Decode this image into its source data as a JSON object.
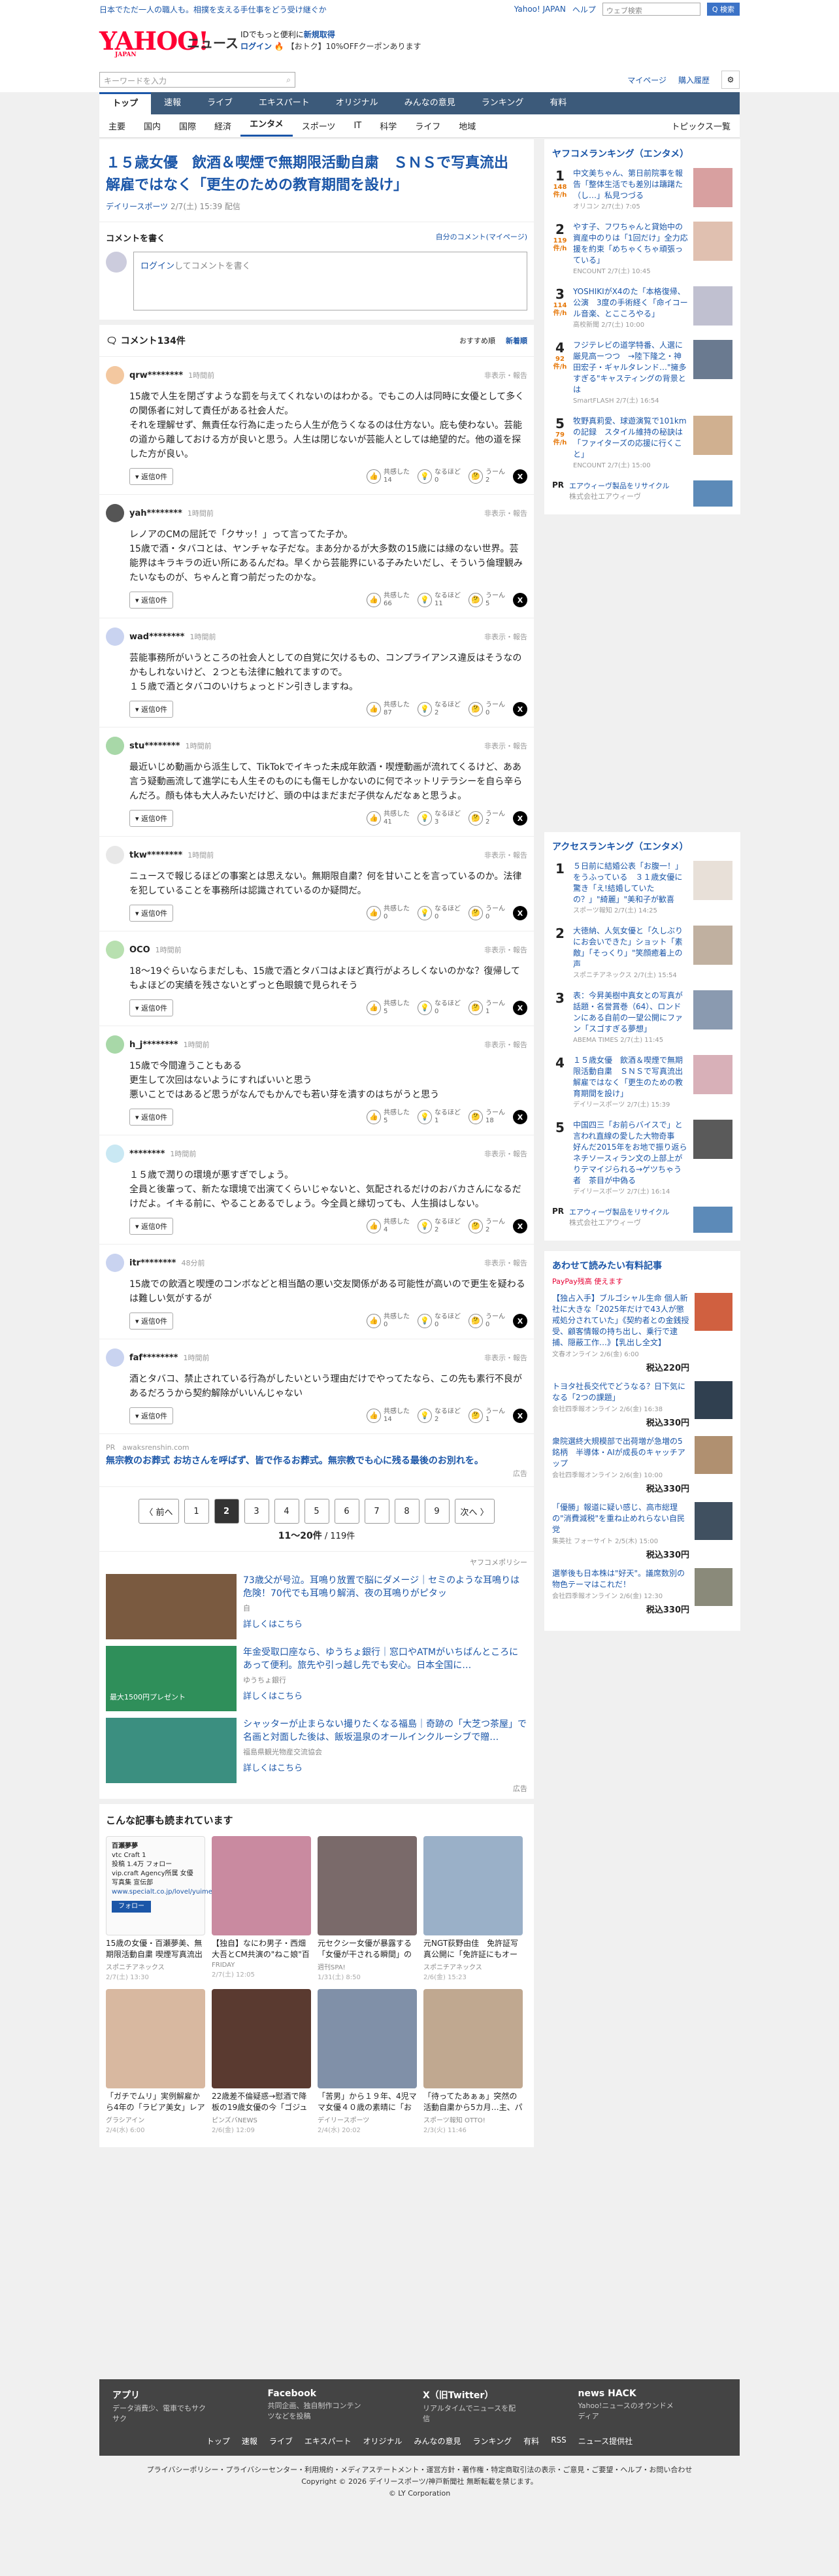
{
  "top": {
    "promo": "日本でただ一人の職人も。相撲を支える手仕事をどう受け継ぐか",
    "links": [
      "Yahoo! JAPAN",
      "ヘルプ"
    ],
    "search_ph": "ウェブ検索",
    "search_btn": "Q 検索"
  },
  "header": {
    "logo": "YAHOO!",
    "logo_sub": "JAPAN",
    "news": "ニュース",
    "id_line1": "IDでもっと便利に",
    "id_line1b": "新規取得",
    "id_line2": "ログイン",
    "id_line2b": "【おトク】10%OFFクーポンあります"
  },
  "search": {
    "placeholder": "キーワードを入力",
    "mypage": "マイページ",
    "history": "購入履歴"
  },
  "nav": [
    "トップ",
    "速報",
    "ライブ",
    "エキスパート",
    "オリジナル",
    "みんなの意見",
    "ランキング",
    "有料"
  ],
  "subnav": [
    "主要",
    "国内",
    "国際",
    "経済",
    "エンタメ",
    "スポーツ",
    "IT",
    "科学",
    "ライフ",
    "地域"
  ],
  "topics": "トピックス一覧",
  "article": {
    "title": "１５歳女優　飲酒＆喫煙で無期限活動自粛　ＳＮＳで写真流出　解雇ではなく「更生のための教育期間を設け」",
    "source": "デイリースポーツ",
    "date": "2/7(土) 15:39 配信"
  },
  "write": {
    "title": "コメントを書く",
    "mine": "自分のコメント(マイページ)",
    "login": "ログイン",
    "prompt": "してコメントを書く"
  },
  "comments_head": {
    "count": "コメント134件",
    "sort1": "おすすめ順",
    "sort2": "新着順"
  },
  "labels": {
    "report": "非表示・報告",
    "reply": "▾ 返信0件",
    "like": "共感した",
    "nrh": "なるほど",
    "hmm": "うーん"
  },
  "comments": [
    {
      "user": "qrw********",
      "time": "1時間前",
      "text": "15歳で人生を閉ざすような罰を与えてくれないのはわかる。でもこの人は同時に女優として多くの関係者に対して責任がある社会人だ。\nそれを理解せず、無責任な行為に走ったら人生が危うくなるのは仕方ない。庇も使わない。芸能の道から離しておける方が良いと思う。人生は閉じないが芸能人としては絶望的だ。他の道を探した方が良い。",
      "a": "14",
      "b": "0",
      "c": "2"
    },
    {
      "user": "yah********",
      "time": "1時間前",
      "text": "レノアのCMの屈託で「クサッ！」って言ってた子か。\n15歳で酒・タバコとは、ヤンチャな子だな。まあ分かるが大多数の15歳には縁のない世界。芸能界はキラキラの近い所にあるんだね。早くから芸能界にいる子みたいだし、そういう倫理観みたいなものが、ちゃんと育つ前だったのかな。",
      "a": "66",
      "b": "11",
      "c": "5"
    },
    {
      "user": "wad********",
      "time": "1時間前",
      "text": "芸能事務所がいうところの社会人としての自覚に欠けるもの、コンプライアンス違反はそうなのかもしれないけど、２つとも法律に触れてますので。\n１５歳で酒とタバコのいけちょっとドン引きしますね。",
      "a": "87",
      "b": "2",
      "c": "0"
    },
    {
      "user": "stu********",
      "time": "1時間前",
      "text": "最近いじめ動画から派生して、TikTokでイキった未成年飲酒・喫煙動画が流れてくるけど、ああ言う疑動画流して進学にも人生そのものにも傷モしかないのに何でネットリテラシーを自ら辛らんだろ。顔も体も大人みたいだけど、頭の中はまだまだ子供なんだなぁと思うよ。",
      "a": "41",
      "b": "3",
      "c": "2"
    },
    {
      "user": "tkw********",
      "time": "1時間前",
      "text": "ニュースで報じるほどの事案とは思えない。無期限自粛？何を甘いことを言っているのか。法律を犯していることを事務所は認識されているのか疑問だ。",
      "a": "0",
      "b": "0",
      "c": "0"
    },
    {
      "user": "OCO",
      "time": "1時間前",
      "text": "18〜19ぐらいならまだしも、15歳で酒とタバコはよほど真行がよろしくないのかな？復帰してもよほどの実績を残さないとずっと色眼鏡で見られそう",
      "a": "5",
      "b": "0",
      "c": "1"
    },
    {
      "user": "h_j********",
      "time": "1時間前",
      "text": "15歳で今間違うこともある\n更生して次回はないようにすればいいと思う\n悪いことではあるど思うがなんでもかんでも若い芽を潰すのはちがうと思う",
      "a": "5",
      "b": "1",
      "c": "18"
    },
    {
      "user": "********",
      "time": "1時間前",
      "text": "１５歳で潤りの環境が悪すぎでしょう。\n全員と後輩って、新たな環境で出演てくらいじゃないと、気配されるだけのおバカさんになるだけだよ。イキる前に、やることあるでしょう。今全員と縁切っても、人生損はしない。",
      "a": "4",
      "b": "2",
      "c": "2"
    },
    {
      "user": "itr********",
      "time": "48分前",
      "text": "15歳での飲酒と喫煙のコンボなどと相当酷の悪い交友関係がある可能性が高いので更生を疑わるは難しい気がするが",
      "a": "0",
      "b": "0",
      "c": "0"
    },
    {
      "user": "faf********",
      "time": "1時間前",
      "text": "酒とタバコ、禁止されている行為がしたいという理由だけでやってたなら、この先も素行不良があるだろうから契約解除がいいんじゃない",
      "a": "14",
      "b": "2",
      "c": "1"
    }
  ],
  "ad": {
    "pr": "PR",
    "domain": "awaksrenshin.com",
    "text": "無宗教のお葬式 お坊さんを呼ばず、皆で作るお葬式。無宗教でも心に残る最後のお別れを。",
    "tag": "広告"
  },
  "pager": {
    "prev": "〈 前へ",
    "pages": [
      "1",
      "2",
      "3",
      "4",
      "5",
      "6",
      "7",
      "8",
      "9"
    ],
    "current": "2",
    "next": "次へ 〉",
    "range": "11〜20件",
    "total": "/ 119件"
  },
  "sponsor": {
    "policy": "ヤフコメポリシー",
    "items": [
      {
        "title": "73歳父が号泣。耳鳴り放置で脳にダメージ｜セミのような耳鳴りは危険！70代でも耳鳴り解消、夜の耳鳴りがピタッ",
        "src": "自",
        "more": "詳しくはこちら"
      },
      {
        "title": "年金受取口座なら、ゆうちょ銀行｜窓口やATMがいちばんところにあって便利。旅先や引っ越し先でも安心。日本全国に…",
        "src": "ゆうちょ銀行",
        "more": "詳しくはこちら",
        "badge": "最大1500円プレゼント"
      },
      {
        "title": "シャッターが止まらない撮りたくなる福島｜奇跡の「大芝つ茶屋」で名画と対面した後は、飯坂温泉のオールインクルーシブで贈…",
        "src": "福島県観光物産交流協会",
        "more": "詳しくはこちら"
      }
    ],
    "tag": "広告"
  },
  "related": {
    "title": "こんな記事も読まれています",
    "items": [
      {
        "t": "15歳の女優・百瀬夢美、無期限活動自粛 喫煙写真流出に事務所…",
        "s": "スポニチアネックス",
        "d": "2/7(土) 13:30"
      },
      {
        "t": "【独自】なにわ男子・西畑大吾とCM共演の\"ねこ娘\"百瀬夢夢が…",
        "s": "FRIDAY",
        "d": "2/7(土) 12:05"
      },
      {
        "t": "元セクシー女優が暴露する「女優が干される瞬間」のリアル。簡…",
        "s": "週刊SPA!",
        "d": "1/31(土) 8:50"
      },
      {
        "t": "元NGT荻野由佳　免許証写真公開に「免許証にもオーラが」「こん…",
        "s": "スポニチアネックス",
        "d": "2/6(金) 15:23"
      },
      {
        "t": "「ガチでムリ」実例解雇から4年の「ラビア美女」レアな発言フ…",
        "s": "グラシアイン",
        "d": "2/4(水) 6:00"
      },
      {
        "t": "22歳差不倫疑惑→慰酒で降板の19歳女優の今「ゴジュウジャー…",
        "s": "ピンズバNEWS",
        "d": "2/6(金) 12:09"
      },
      {
        "t": "「苦男」から１９年、4児ママ女優４０歳の素晴に「お人形さん…",
        "s": "デイリースポーツ",
        "d": "2/4(水) 20:02"
      },
      {
        "t": "「待ってたあぁぁ」突然の活動自粛から5カ月…主、パパになっ…",
        "s": "スポーツ報知 OTTO!",
        "d": "2/3(火) 11:46"
      }
    ],
    "ad": {
      "name": "百瀬夢夢",
      "handle": "vtc Craft 1",
      "posts": "投稿",
      "followers": "1.4万",
      "following": "フォロー",
      "desc": "vip.craft Agency所属 女優 写真集 宣伝部",
      "url": "www.specialt.co.jp/lovel/yuime",
      "follow": "フォロー"
    }
  },
  "ranking": {
    "title": "ヤフコメランキング（エンタメ）",
    "unit": "件/h",
    "items": [
      {
        "no": "1",
        "pv": "148",
        "t": "中文美ちゃん、第日前院事を報告「整体生活でも差別は躊躇た（し…」私見つづる",
        "s": "オリコン 2/7(土) 7:05"
      },
      {
        "no": "2",
        "pv": "119",
        "t": "やす子、フワちゃんと貸始中の資産中のりは「1回だけ」全力応援を約束「めちゃくちゃ頑張っている」",
        "s": "ENCOUNT 2/7(土) 10:45"
      },
      {
        "no": "3",
        "pv": "114",
        "t": "YOSHIKIがX4のた「本格復帰、公演　3度の手術経く「命イコール音楽、とこころやる」",
        "s": "高校新聞 2/7(土) 10:00"
      },
      {
        "no": "4",
        "pv": "92",
        "t": "フジテレビの道学特番、人選に厳見高ーつつ　→陸下隆之・神田宏子・ギャルタレンド…\"擁多すぎる\"キャスティングの背景とは",
        "s": "SmartFLASH 2/7(土) 16:54"
      },
      {
        "no": "5",
        "pv": "79",
        "t": "牧野真莉愛、球遊演覧で101kmの記録　スタイル維持の秘訣は「ファイターズの応援に行くこと」",
        "s": "ENCOUNT 2/7(土) 15:00"
      }
    ],
    "pr": {
      "label": "PR",
      "t": "エアウィーヴ製品をリサイクル",
      "s": "株式会社エアウィーヴ"
    }
  },
  "access": {
    "title": "アクセスランキング（エンタメ）",
    "items": [
      {
        "no": "1",
        "t": "５日前に結婚公表「お腹一！」をうふっている　３１歳女優に驚き「え!結婚していたの？」\"綺麗」\"美和子が歓喜",
        "s": "スポーツ報知 2/7(土) 14:25"
      },
      {
        "no": "2",
        "t": "大徳納、人気女優と「久しぶりにお会いできた」ショット「素敵」「そっくり」\"笑顔癒着上の声",
        "s": "スポニチアネックス 2/7(土) 15:54"
      },
      {
        "no": "3",
        "t": "表：今昇美樹中真女との写真が話題・名誉賞巻（64）、ロンドンにある自前の一望公開にファン「スゴすぎる夢想」",
        "s": "ABEMA TIMES 2/7(土) 11:45"
      },
      {
        "no": "4",
        "t": "１５歳女優　飲酒＆喫煙で無期限活動自粛　ＳＮＳで写真流出　解雇ではなく「更生のための教育期間を設け」",
        "s": "デイリースポーツ 2/7(土) 15:39"
      },
      {
        "no": "5",
        "t": "中国四三「お前らバイスで」と言われ直線の愛した大物奇事　好んだ2015年をお地で振り返らネチソースィラン文の上部上がりテマイジられる→ゲツちゃう者　茶目が中偽る",
        "s": "デイリースポーツ 2/7(土) 16:14"
      }
    ],
    "pr": {
      "label": "PR",
      "t": "エアウィーヴ製品をリサイクル",
      "s": "株式会社エアウィーヴ"
    }
  },
  "paid": {
    "title": "あわせて読みたい有料記事",
    "pp": "PayPay残高 使えます",
    "items": [
      {
        "t": "【独占入手】ブルゴシャル生命 個人新社に大きな「2025年だけで43人が懲戒処分されていた」《契約者との金銭授受、顧客情報の持ち出し、乗行で逮捕、隠蔽工作…》【乳出し全文】",
        "s": "文春オンライン 2/6(金) 6:00",
        "p": "税込220円"
      },
      {
        "t": "トヨタ社長交代でどうなる？日下気になる「2つの課題」",
        "s": "会社四季報オンライン 2/6(金) 16:38",
        "p": "税込330円"
      },
      {
        "t": "衆院選終大規模部で出荷増が急増の5銘柄　半導体・AIが成長のキャッチアップ",
        "s": "会社四季報オンライン 2/6(金) 10:00",
        "p": "税込330円"
      },
      {
        "t": "「優勝」報道に疑い感じ、高市総理の\"消費減税\"を重ね止めれらない自民党",
        "s": "集英社 フォーサイト 2/5(木) 15:00",
        "p": "税込330円"
      },
      {
        "t": "選挙後も日本株は\"好天\"。議席数別の物色テーマはこれだ！",
        "s": "会社四季報オンライン 2/6(金) 12:30",
        "p": "税込330円"
      }
    ]
  },
  "footer": {
    "apps": [
      {
        "t": "アプリ",
        "s": "データ消費少、電車でもサクサク"
      },
      {
        "t": "Facebook",
        "s": "共同企画、独自制作コンテンツなどを投稿"
      },
      {
        "t": "X（旧Twitter）",
        "s": "リアルタイムでニュースを配信"
      },
      {
        "t": "news HACK",
        "s": "Yahoo!ニュースのオウンドメディア"
      }
    ],
    "links": [
      "トップ",
      "速報",
      "ライブ",
      "エキスパート",
      "オリジナル",
      "みんなの意見",
      "ランキング",
      "有料",
      "RSS",
      "ニュース提供社"
    ],
    "legal": "プライバシーポリシー・プライバシーセンター・利用規約・メディアステートメント・運営方針・著作権・特定商取引法の表示・ご意見・ご要望・ヘルプ・お問い合わせ",
    "copy1": "Copyright © 2026 デイリースポーツ/神戸新聞社 無断転載を禁じます。",
    "copy2": "© LY Corporation"
  }
}
